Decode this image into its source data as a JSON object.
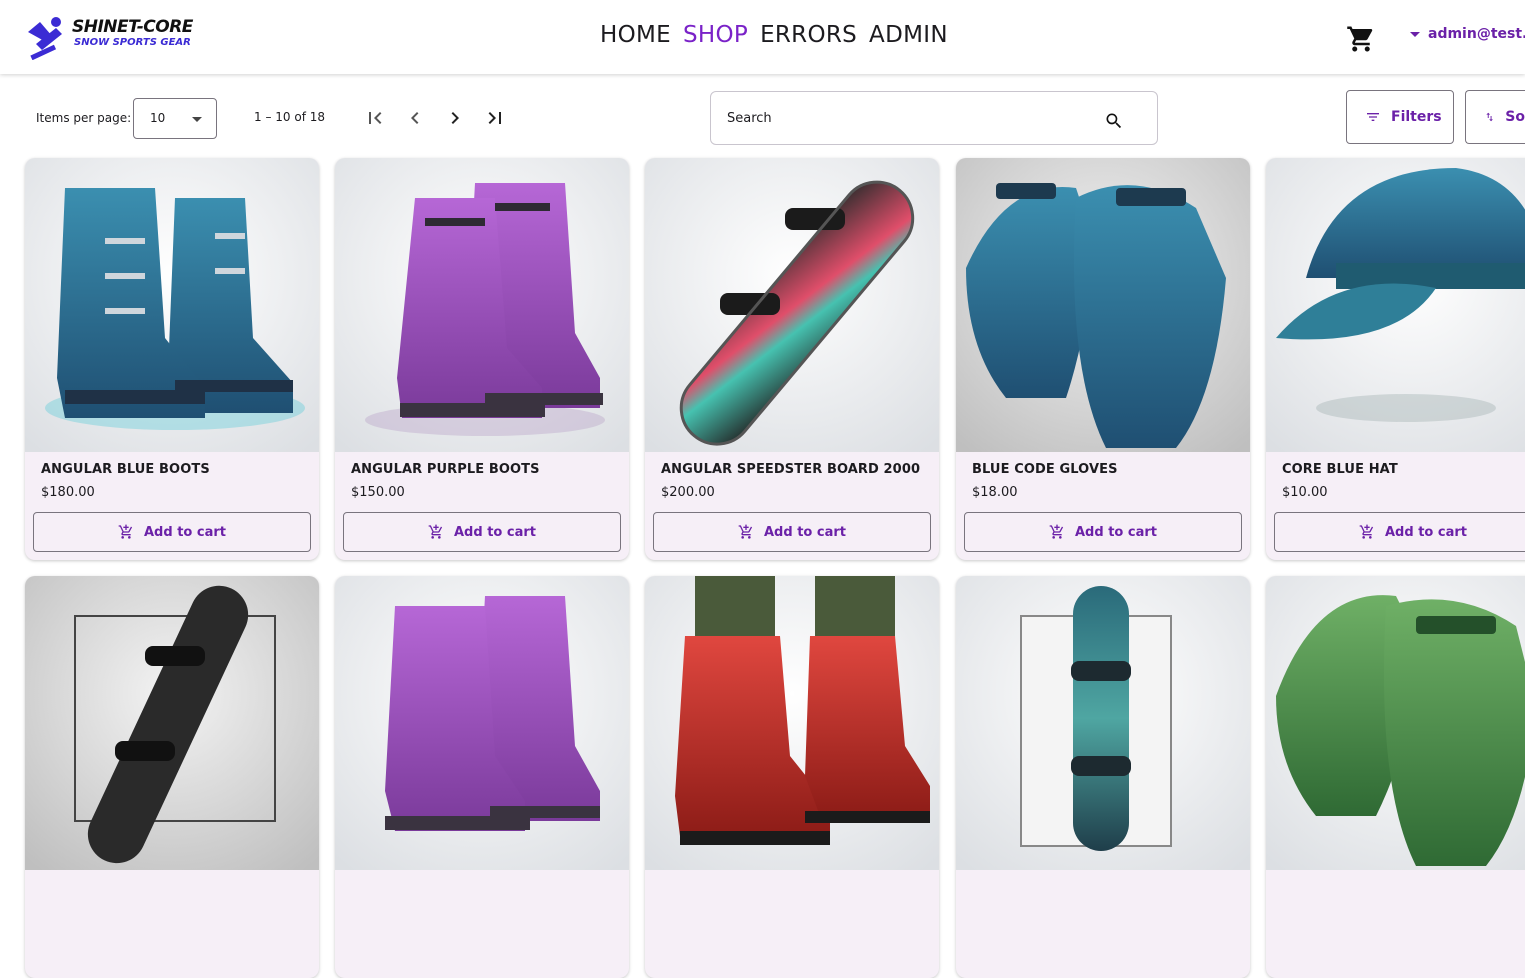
{
  "brand": {
    "title": "SHINET-CORE",
    "subtitle": "SNOW SPORTS GEAR",
    "accent": "#3b2bd4"
  },
  "nav": [
    {
      "label": "HOME",
      "active": false
    },
    {
      "label": "SHOP",
      "active": true
    },
    {
      "label": "ERRORS",
      "active": false
    },
    {
      "label": "ADMIN",
      "active": false
    }
  ],
  "header": {
    "cart_icon": "shopping-cart-icon",
    "user_email": "admin@test.c"
  },
  "toolbar": {
    "items_per_page_label": "Items per page:",
    "items_per_page_value": "10",
    "range_label": "1 – 10 of 18",
    "search_placeholder": "Search",
    "filters_label": "Filters",
    "sort_label": "So"
  },
  "products": [
    {
      "name": "ANGULAR BLUE BOOTS",
      "price": "$180.00",
      "add_label": "Add to cart",
      "image": "blue-boots"
    },
    {
      "name": "ANGULAR PURPLE BOOTS",
      "price": "$150.00",
      "add_label": "Add to cart",
      "image": "purple-boots"
    },
    {
      "name": "ANGULAR SPEEDSTER BOARD 2000",
      "price": "$200.00",
      "add_label": "Add to cart",
      "image": "speedster-board"
    },
    {
      "name": "BLUE CODE GLOVES",
      "price": "$18.00",
      "add_label": "Add to cart",
      "image": "blue-gloves"
    },
    {
      "name": "CORE BLUE HAT",
      "price": "$10.00",
      "add_label": "Add to cart",
      "image": "blue-hat"
    }
  ],
  "products_row2": [
    {
      "image": "dark-snowboard"
    },
    {
      "image": "purple-boots-2"
    },
    {
      "image": "red-boots"
    },
    {
      "image": "teal-snowboard"
    },
    {
      "image": "green-gloves"
    }
  ],
  "colors": {
    "accent": "#6b21a8",
    "nav_active": "#7a22c8",
    "card_bg": "#f6eff7"
  }
}
